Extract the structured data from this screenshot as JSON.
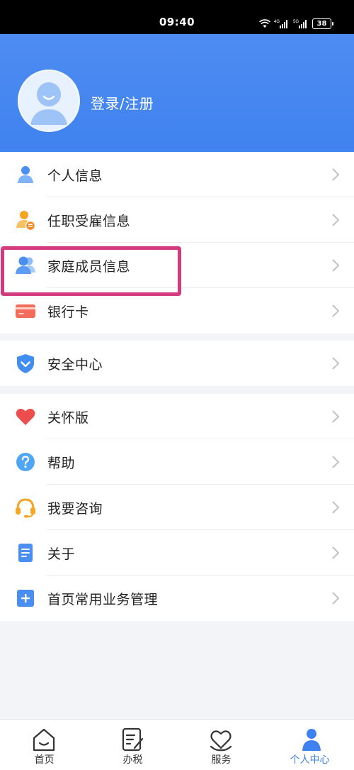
{
  "status_bar": {
    "time": "09:40",
    "battery": "38"
  },
  "header": {
    "login_label": "登录/注册"
  },
  "menu_group_1": [
    {
      "label": "个人信息",
      "icon": "person-icon"
    },
    {
      "label": "任职受雇信息",
      "icon": "employment-icon"
    },
    {
      "label": "家庭成员信息",
      "icon": "family-icon"
    },
    {
      "label": "银行卡",
      "icon": "bank-card-icon"
    }
  ],
  "menu_group_2": [
    {
      "label": "安全中心",
      "icon": "shield-icon"
    }
  ],
  "menu_group_3": [
    {
      "label": "关怀版",
      "icon": "heart-icon"
    },
    {
      "label": "帮助",
      "icon": "help-icon"
    },
    {
      "label": "我要咨询",
      "icon": "headset-icon"
    },
    {
      "label": "关于",
      "icon": "document-icon"
    },
    {
      "label": "首页常用业务管理",
      "icon": "plus-square-icon"
    }
  ],
  "tabbar": [
    {
      "label": "首页",
      "icon": "home-icon"
    },
    {
      "label": "办税",
      "icon": "tax-icon"
    },
    {
      "label": "服务",
      "icon": "service-icon"
    },
    {
      "label": "个人中心",
      "icon": "profile-icon",
      "active": true
    }
  ],
  "colors": {
    "header_blue": "#3f82ef",
    "highlight_magenta": "#d43b7e",
    "page_bg": "#f2f4f7"
  }
}
